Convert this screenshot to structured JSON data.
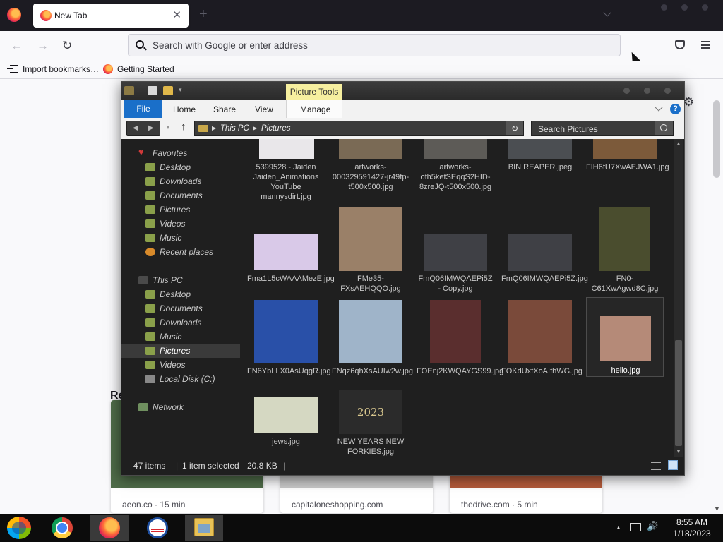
{
  "browser": {
    "tab_title": "New Tab",
    "tab_close": "✕",
    "new_tab": "+",
    "url_placeholder": "Search with Google or enter address",
    "back": "←",
    "forward": "→",
    "reload": "↻",
    "bookmarks": [
      "Import bookmarks…",
      "Getting Started"
    ]
  },
  "page": {
    "heading": "Re",
    "settings_icon": "⚙",
    "stories": [
      {
        "source": "aeon.co · 15 min",
        "color": "#4e6b48"
      },
      {
        "source": "capitaloneshopping.com",
        "color": "#c9c9c9"
      },
      {
        "source": "thedrive.com · 5 min",
        "color": "#b45a3a"
      }
    ]
  },
  "explorer": {
    "context_tab": "Picture Tools",
    "ribbon_tabs": [
      "File",
      "Home",
      "Share",
      "View",
      "Manage"
    ],
    "help": "?",
    "path": [
      "This PC",
      "Pictures"
    ],
    "refresh": "↻",
    "search_placeholder": "Search Pictures",
    "nav": {
      "favorites_label": "Favorites",
      "favorites": [
        "Desktop",
        "Downloads",
        "Documents",
        "Pictures",
        "Videos",
        "Music",
        "Recent places"
      ],
      "thispc_label": "This PC",
      "thispc": [
        "Desktop",
        "Documents",
        "Downloads",
        "Music",
        "Pictures",
        "Videos",
        "Local Disk (C:)"
      ],
      "network_label": "Network",
      "selected": "Pictures"
    },
    "files": [
      {
        "name": "5399528 - Jaiden Jaiden_Animations YouTube mannysdirt.jpg",
        "color": "#e9e7ea"
      },
      {
        "name": "artworks-000329591427-jr49fp-t500x500.jpg",
        "color": "#7a6a55"
      },
      {
        "name": "artworks-ofh5ketSEqqS2HID-8zreJQ-t500x500.jpg",
        "color": "#5d5b57"
      },
      {
        "name": "BIN REAPER.jpeg",
        "color": "#4b4e52"
      },
      {
        "name": "FIH6fU7XwAEJWA1.jpg",
        "color": "#7c5a3a"
      },
      {
        "name": "Fma1L5cWAAAMezE.jpg",
        "color": "#d9c9e8"
      },
      {
        "name": "FMe35-FXsAEHQQO.jpg",
        "color": "#9a8068"
      },
      {
        "name": "FmQ06IMWQAEPi5Z - Copy.jpg",
        "color": "#3f4045"
      },
      {
        "name": "FmQ06IMWQAEPi5Z.jpg",
        "color": "#3f4045"
      },
      {
        "name": "FN0-C61XwAgwd8C.jpg",
        "color": "#4a4d2e"
      },
      {
        "name": "FN6YbLLX0AsUqgR.jpg",
        "color": "#2950a8"
      },
      {
        "name": "FNqz6qhXsAUIw2w.jpg",
        "color": "#9fb4c9"
      },
      {
        "name": "FOEnj2KWQAYGS99.jpg",
        "color": "#5a2e2e"
      },
      {
        "name": "FOKdUxfXoAIfhWG.jpg",
        "color": "#7a4a3a"
      },
      {
        "name": "hello.jpg",
        "color": "#b58a78"
      },
      {
        "name": "jews.jpg",
        "color": "#d5d8c2"
      },
      {
        "name": "NEW YEARS NEW FORKIES.jpg",
        "color": "#2b2b2b"
      }
    ],
    "new_year_text": "2023",
    "status": {
      "count": "47 items",
      "selection": "1 item selected",
      "size": "20.8 KB"
    }
  },
  "taskbar": {
    "time": "8:55 AM",
    "date": "1/18/2023",
    "tray_chevron": "▲",
    "volume_icon": "🔊"
  }
}
